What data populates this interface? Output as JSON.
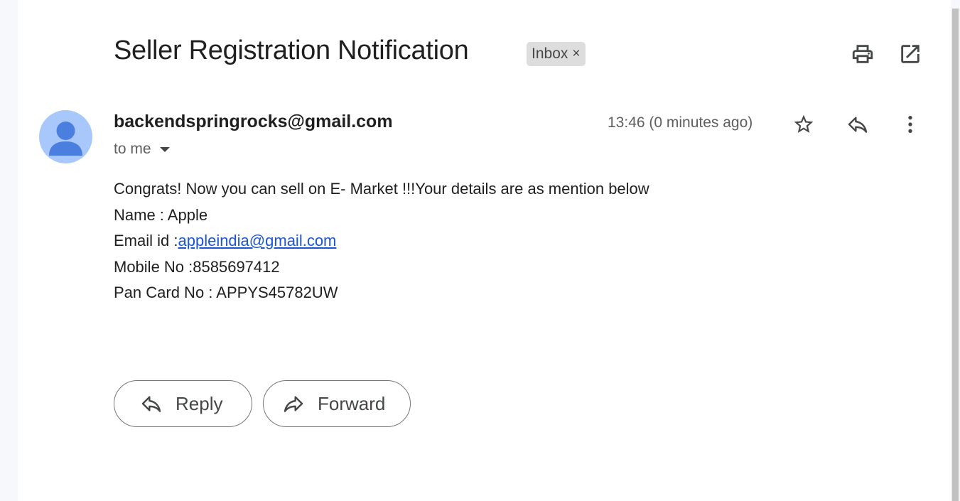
{
  "email": {
    "subject": "Seller Registration Notification",
    "label": "Inbox",
    "label_remove": "×",
    "sender": "backendspringrocks@gmail.com",
    "recipient": "to me",
    "timestamp": "13:46 (0 minutes ago)",
    "body": {
      "line1": "Congrats! Now you can sell on E- Market !!!Your details are as mention below",
      "name_line": "Name : Apple",
      "email_prefix": "Email id :",
      "email_link": "appleindia@gmail.com",
      "mobile_line": "Mobile No :8585697412",
      "pan_line": "Pan Card No : APPYS45782UW"
    }
  },
  "header_actions": {
    "print_icon": "print-icon",
    "new_window_icon": "open-in-new-window-icon"
  },
  "message_actions": {
    "star_icon": "star-icon",
    "reply_icon": "reply-icon",
    "more_icon": "more-vertical-icon"
  },
  "buttons": {
    "reply": "Reply",
    "forward": "Forward"
  },
  "colors": {
    "link": "#1a55d6",
    "avatar_bg": "#a8c7fa",
    "avatar_fg": "#4a7fe0",
    "chip_bg": "#dddddd"
  }
}
